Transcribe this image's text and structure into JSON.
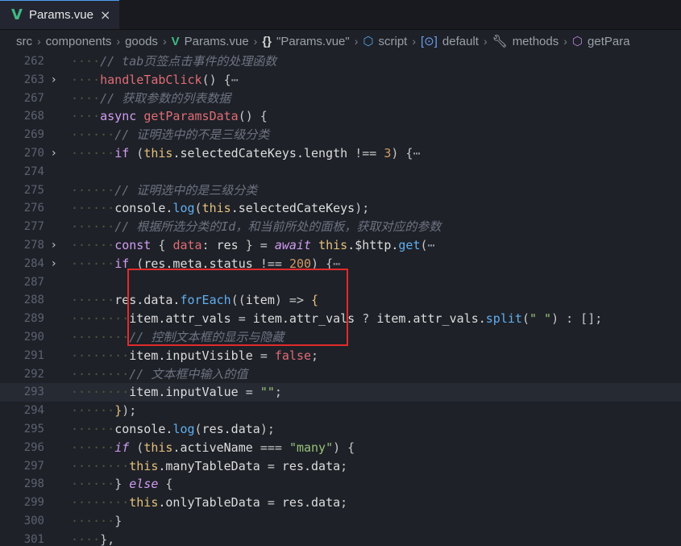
{
  "tab": {
    "label": "Params.vue",
    "close": "×",
    "icon": "vue-icon"
  },
  "breadcrumb": [
    "src",
    "components",
    "goods",
    "Params.vue",
    "\"Params.vue\"",
    "script",
    "default",
    "methods",
    "getPara"
  ],
  "lines": [
    {
      "n": "262",
      "fold": false,
      "segs": [
        [
          "ws",
          "····"
        ],
        [
          "cm",
          "// tab页签点击事件的处理函数"
        ]
      ]
    },
    {
      "n": "263",
      "fold": true,
      "segs": [
        [
          "ws",
          "····"
        ],
        [
          "fn",
          "handleTabClick"
        ],
        [
          "op",
          "() {"
        ],
        [
          "fold-dots",
          "⋯"
        ]
      ]
    },
    {
      "n": "267",
      "fold": false,
      "segs": [
        [
          "ws",
          "····"
        ],
        [
          "cm",
          "// 获取参数的列表数据"
        ]
      ]
    },
    {
      "n": "268",
      "fold": false,
      "segs": [
        [
          "ws",
          "····"
        ],
        [
          "kw",
          "async "
        ],
        [
          "fn",
          "getParamsData"
        ],
        [
          "op",
          "() {"
        ]
      ]
    },
    {
      "n": "269",
      "fold": false,
      "segs": [
        [
          "ws",
          "······"
        ],
        [
          "cm",
          "// 证明选中的不是三级分类"
        ]
      ]
    },
    {
      "n": "270",
      "fold": true,
      "segs": [
        [
          "ws",
          "······"
        ],
        [
          "kw",
          "if "
        ],
        [
          "op",
          "("
        ],
        [
          "this",
          "this"
        ],
        [
          "pl",
          ".selectedCateKeys.length "
        ],
        [
          "op",
          "!== "
        ],
        [
          "num",
          "3"
        ],
        [
          "op",
          ") {"
        ],
        [
          "fold-dots",
          "⋯"
        ]
      ]
    },
    {
      "n": "274",
      "fold": false,
      "segs": []
    },
    {
      "n": "275",
      "fold": false,
      "segs": [
        [
          "ws",
          "······"
        ],
        [
          "cm",
          "// 证明选中的是三级分类"
        ]
      ]
    },
    {
      "n": "276",
      "fold": false,
      "segs": [
        [
          "ws",
          "······"
        ],
        [
          "pl",
          "console."
        ],
        [
          "fnb",
          "log"
        ],
        [
          "op",
          "("
        ],
        [
          "this",
          "this"
        ],
        [
          "pl",
          ".selectedCateKeys"
        ],
        [
          "op",
          ");"
        ]
      ]
    },
    {
      "n": "277",
      "fold": false,
      "segs": [
        [
          "ws",
          "······"
        ],
        [
          "cm",
          "// 根据所选分类的Id，和当前所处的面板，获取对应的参数"
        ]
      ]
    },
    {
      "n": "278",
      "fold": true,
      "segs": [
        [
          "ws",
          "······"
        ],
        [
          "kw",
          "const "
        ],
        [
          "op",
          "{ "
        ],
        [
          "fn",
          "data"
        ],
        [
          "op",
          ": "
        ],
        [
          "pl",
          "res "
        ],
        [
          "op",
          "} = "
        ],
        [
          "kwi",
          "await "
        ],
        [
          "this",
          "this"
        ],
        [
          "pl",
          ".$http."
        ],
        [
          "fnb",
          "get"
        ],
        [
          "op",
          "("
        ],
        [
          "fold-dots",
          "⋯"
        ]
      ]
    },
    {
      "n": "284",
      "fold": true,
      "segs": [
        [
          "ws",
          "······"
        ],
        [
          "kw",
          "if "
        ],
        [
          "op",
          "("
        ],
        [
          "pl",
          "res.meta.status "
        ],
        [
          "op",
          "!== "
        ],
        [
          "num",
          "200"
        ],
        [
          "op",
          ") {"
        ],
        [
          "fold-dots",
          "⋯"
        ]
      ]
    },
    {
      "n": "287",
      "fold": false,
      "segs": []
    },
    {
      "n": "288",
      "fold": false,
      "segs": [
        [
          "ws",
          "······"
        ],
        [
          "pl",
          "res.data."
        ],
        [
          "fnb",
          "forEach"
        ],
        [
          "op",
          "(("
        ],
        [
          "pl",
          "item"
        ],
        [
          "op",
          ") => "
        ],
        [
          "brk",
          "{"
        ]
      ]
    },
    {
      "n": "289",
      "fold": false,
      "segs": [
        [
          "ws",
          "········"
        ],
        [
          "pl",
          "item.attr_vals "
        ],
        [
          "op",
          "= "
        ],
        [
          "pl",
          "item.attr_vals "
        ],
        [
          "op",
          "? "
        ],
        [
          "pl",
          "item.attr_vals."
        ],
        [
          "fnb",
          "split"
        ],
        [
          "op",
          "("
        ],
        [
          "str",
          "\" \""
        ],
        [
          "op",
          ") : [];"
        ]
      ]
    },
    {
      "n": "290",
      "fold": false,
      "segs": [
        [
          "ws",
          "········"
        ],
        [
          "cm",
          "// 控制文本框的显示与隐藏"
        ]
      ]
    },
    {
      "n": "291",
      "fold": false,
      "segs": [
        [
          "ws",
          "········"
        ],
        [
          "pl",
          "item.inputVisible "
        ],
        [
          "op",
          "= "
        ],
        [
          "bool",
          "false"
        ],
        [
          "op",
          ";"
        ]
      ]
    },
    {
      "n": "292",
      "fold": false,
      "segs": [
        [
          "ws",
          "········"
        ],
        [
          "cm",
          "// 文本框中输入的值"
        ]
      ]
    },
    {
      "n": "293",
      "fold": false,
      "current": true,
      "segs": [
        [
          "ws",
          "········"
        ],
        [
          "pl",
          "item.inputValue "
        ],
        [
          "op",
          "= "
        ],
        [
          "str",
          "\"\""
        ],
        [
          "op",
          ";"
        ]
      ]
    },
    {
      "n": "294",
      "fold": false,
      "segs": [
        [
          "ws",
          "······"
        ],
        [
          "brk",
          "}"
        ],
        [
          "op",
          ");"
        ]
      ]
    },
    {
      "n": "295",
      "fold": false,
      "segs": [
        [
          "ws",
          "······"
        ],
        [
          "pl",
          "console."
        ],
        [
          "fnb",
          "log"
        ],
        [
          "op",
          "("
        ],
        [
          "pl",
          "res.data"
        ],
        [
          "op",
          ");"
        ]
      ]
    },
    {
      "n": "296",
      "fold": false,
      "segs": [
        [
          "ws",
          "······"
        ],
        [
          "kwi",
          "if "
        ],
        [
          "op",
          "("
        ],
        [
          "this",
          "this"
        ],
        [
          "pl",
          ".activeName "
        ],
        [
          "op",
          "=== "
        ],
        [
          "str",
          "\"many\""
        ],
        [
          "op",
          ") {"
        ]
      ]
    },
    {
      "n": "297",
      "fold": false,
      "segs": [
        [
          "ws",
          "········"
        ],
        [
          "this",
          "this"
        ],
        [
          "pl",
          ".manyTableData "
        ],
        [
          "op",
          "= "
        ],
        [
          "pl",
          "res.data"
        ],
        [
          "op",
          ";"
        ]
      ]
    },
    {
      "n": "298",
      "fold": false,
      "segs": [
        [
          "ws",
          "······"
        ],
        [
          "op",
          "} "
        ],
        [
          "kwi",
          "else "
        ],
        [
          "op",
          "{"
        ]
      ]
    },
    {
      "n": "299",
      "fold": false,
      "segs": [
        [
          "ws",
          "········"
        ],
        [
          "this",
          "this"
        ],
        [
          "pl",
          ".onlyTableData "
        ],
        [
          "op",
          "= "
        ],
        [
          "pl",
          "res.data"
        ],
        [
          "op",
          ";"
        ]
      ]
    },
    {
      "n": "300",
      "fold": false,
      "segs": [
        [
          "ws",
          "······"
        ],
        [
          "op",
          "}"
        ]
      ]
    },
    {
      "n": "301",
      "fold": false,
      "segs": [
        [
          "ws",
          "····"
        ],
        [
          "op",
          "},"
        ]
      ]
    }
  ]
}
